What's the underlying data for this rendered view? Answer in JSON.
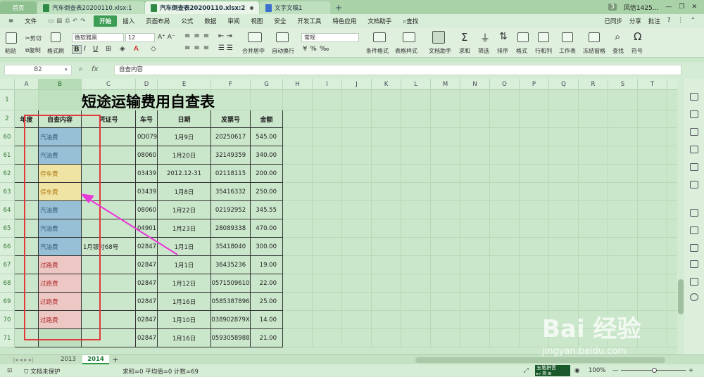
{
  "doc_tabs": [
    {
      "label": "首页"
    },
    {
      "label": "汽车倒查表20200110.xlsx:1"
    },
    {
      "label": "汽车倒查表20200110.xlsx:2"
    },
    {
      "label": "文字文稿1"
    }
  ],
  "tab_right": {
    "count": "3",
    "user": "风信1425..."
  },
  "menu": [
    "文件",
    "开始",
    "插入",
    "页面布局",
    "公式",
    "数据",
    "审阅",
    "视图",
    "安全",
    "开发工具",
    "特色应用",
    "文档助手",
    "查找"
  ],
  "menu_right": [
    "已同步",
    "分享",
    "批注"
  ],
  "ribbon": {
    "paste": "粘贴",
    "cut": "剪切",
    "copy": "复制",
    "format_painter": "格式刷",
    "font_name": "微软雅黑",
    "font_size": "12",
    "number_format": "常规",
    "merge": "合并居中",
    "wrap": "自动换行",
    "cond_format": "条件格式",
    "table_style": "表格样式",
    "doc_helper": "文档助手",
    "sum": "求和",
    "filter": "筛选",
    "sort": "排序",
    "format": "格式",
    "rowcol": "行和列",
    "worksheet": "工作表",
    "freeze": "冻结窗格",
    "find": "查找",
    "symbol": "符号"
  },
  "formula_bar": {
    "cell_ref": "B2",
    "fx": "fx",
    "content": "自查内容"
  },
  "columns": [
    "A",
    "B",
    "C",
    "D",
    "E",
    "F",
    "G",
    "H",
    "I",
    "J",
    "K",
    "L",
    "M",
    "N",
    "O",
    "P",
    "Q",
    "R",
    "S",
    "T",
    "U",
    "V",
    "W",
    "X",
    "Y",
    "Z"
  ],
  "selected_column": "B",
  "sheet": {
    "title": "短途运输费用自查表",
    "headers": [
      "年度",
      "自查内容",
      "凭证号",
      "车号",
      "日期",
      "发票号",
      "金额"
    ],
    "rows": [
      {
        "row": "60",
        "content": "汽油费",
        "voucher": "",
        "car": "0D079",
        "date": "1月9日",
        "invoice": "20250617",
        "amount": "545.00",
        "color": "blue"
      },
      {
        "row": "61",
        "content": "汽油费",
        "voucher": "",
        "car": "08060",
        "date": "1月20日",
        "invoice": "32149359",
        "amount": "340.00",
        "color": "blue"
      },
      {
        "row": "62",
        "content": "停车费",
        "voucher": "",
        "car": "03439",
        "date": "2012.12-31",
        "invoice": "02118115",
        "amount": "200.00",
        "color": "yellow"
      },
      {
        "row": "63",
        "content": "停车费",
        "voucher": "",
        "car": "03439",
        "date": "1月8日",
        "invoice": "35416332",
        "amount": "250.00",
        "color": "yellow"
      },
      {
        "row": "64",
        "content": "汽油费",
        "voucher": "",
        "car": "08060",
        "date": "1月22日",
        "invoice": "02192952",
        "amount": "345.55",
        "color": "blue"
      },
      {
        "row": "65",
        "content": "汽油费",
        "voucher": "",
        "car": "04901",
        "date": "1月23日",
        "invoice": "28089338",
        "amount": "470.00",
        "color": "blue"
      },
      {
        "row": "66",
        "content": "汽油费",
        "voucher": "1月银付68号",
        "car": "02847",
        "date": "1月1日",
        "invoice": "35418040",
        "amount": "300.00",
        "color": "blue"
      },
      {
        "row": "67",
        "content": "过路费",
        "voucher": "",
        "car": "02847",
        "date": "1月1日",
        "invoice": "36435236",
        "amount": "19.00",
        "color": "pink"
      },
      {
        "row": "68",
        "content": "过路费",
        "voucher": "",
        "car": "02847",
        "date": "1月12日",
        "invoice": "0571509610",
        "amount": "22.00",
        "color": "pink"
      },
      {
        "row": "69",
        "content": "过路费",
        "voucher": "",
        "car": "02847",
        "date": "1月16日",
        "invoice": "0585387896",
        "amount": "25.00",
        "color": "pink"
      },
      {
        "row": "70",
        "content": "过路费",
        "voucher": "",
        "car": "02847",
        "date": "1月10日",
        "invoice": "038902879X",
        "amount": "14.00",
        "color": "pink"
      },
      {
        "row": "71",
        "content": "",
        "voucher": "",
        "car": "02847",
        "date": "1月16日",
        "invoice": "0593058988",
        "amount": "21.00",
        "color": ""
      }
    ]
  },
  "sheet_tabs": [
    "2013",
    "2014"
  ],
  "active_sheet": "2014",
  "status": {
    "protect": "文档未保护",
    "stats": "求和=0  平均值=0  计数=69",
    "zoom": "100%",
    "ime": "五笔拼音"
  },
  "watermark": {
    "brand": "Bai 经验",
    "url": "jingyan.baidu.com"
  }
}
